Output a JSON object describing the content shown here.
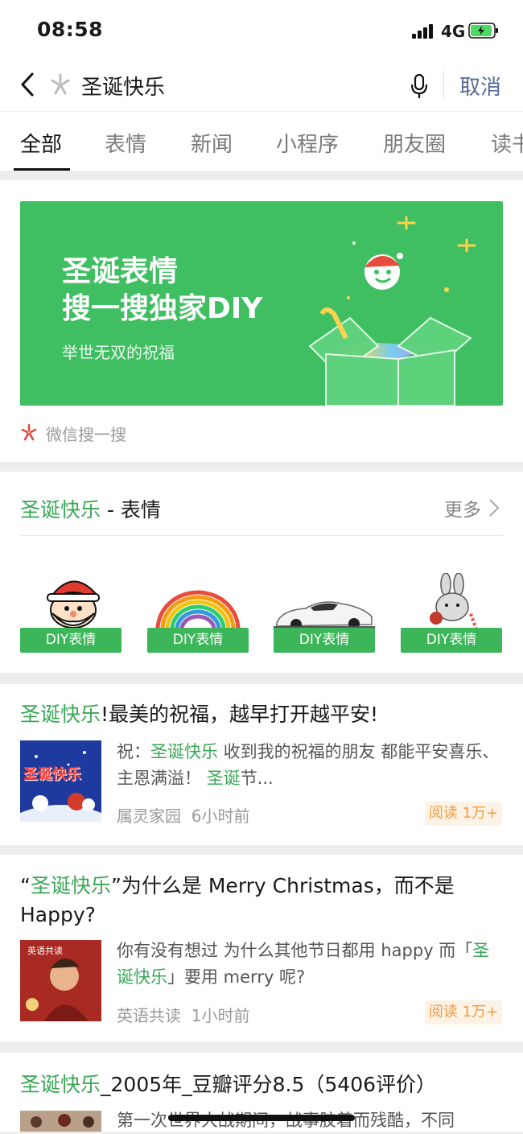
{
  "status_bar": {
    "time": "08:58",
    "network": "4G"
  },
  "search": {
    "query": "圣诞快乐",
    "cancel_label": "取消"
  },
  "tabs": [
    {
      "label": "全部"
    },
    {
      "label": "表情"
    },
    {
      "label": "新闻"
    },
    {
      "label": "小程序"
    },
    {
      "label": "朋友圈"
    },
    {
      "label": "读书"
    }
  ],
  "active_tab": "全部",
  "banner": {
    "line1": "圣诞表情",
    "line2": "搜一搜独家DIY",
    "subtitle": "举世无双的祝福"
  },
  "brand": {
    "text": "微信搜一搜"
  },
  "emoji_section": {
    "title_highlight": "圣诞快乐",
    "title_suffix": " - 表情",
    "more_label": "更多",
    "items": [
      {
        "label": "DIY表情"
      },
      {
        "label": "DIY表情"
      },
      {
        "label": "DIY表情"
      },
      {
        "label": "DIY表情"
      }
    ]
  },
  "articles": [
    {
      "title_highlight": "圣诞快乐",
      "title_rest": "!最美的祝福，越早打开越平安!",
      "desc_parts": [
        "祝：",
        "圣诞快乐",
        " 收到我的祝福的朋友 都能平安喜乐、 主恩满溢！ ",
        "圣诞",
        "节..."
      ],
      "thumb_text": "圣诞快乐",
      "source": "属灵家园",
      "time": "6小时前",
      "read": "阅读 1万+"
    },
    {
      "title_open": "“",
      "title_highlight": "圣诞快乐",
      "title_rest": "”为什么是 Merry Christmas，而不是 Happy?",
      "desc_parts": [
        "你有没有想过 为什么其他节日都用 happy 而「",
        "圣诞快乐",
        "」要用 merry 呢?"
      ],
      "thumb_text": "英语共读",
      "source": "英语共读",
      "time": "1小时前",
      "read": "阅读 1万+"
    },
    {
      "title_highlight": "圣诞快乐",
      "title_rest": "_2005年_豆瓣评分8.5（5406评价）",
      "desc": "第一次世界大战期间，战事胶着而残酷，不同"
    }
  ],
  "colors": {
    "accent_green": "#3aa856",
    "banner_green": "#3fbf61",
    "link_blue": "#576b95",
    "read_orange": "#f29b3f"
  }
}
